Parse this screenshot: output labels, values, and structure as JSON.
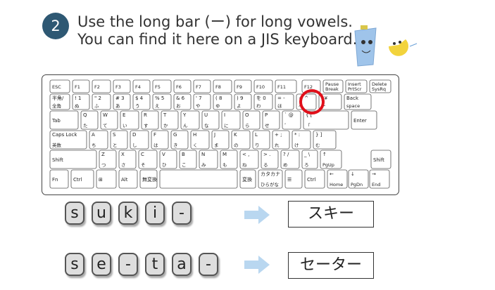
{
  "step": {
    "number": "2"
  },
  "instruction": {
    "text": "Use the long bar (ー) for long vowels. You can find it here on a JIS keyboard."
  },
  "keyboard": {
    "rows": [
      [
        [
          "ESC",
          ""
        ],
        [
          "F1",
          ""
        ],
        [
          "F2",
          ""
        ],
        [
          "F3",
          ""
        ],
        [
          "F4",
          ""
        ],
        [
          "F5",
          ""
        ],
        [
          "F6",
          ""
        ],
        [
          "F7",
          ""
        ],
        [
          "F8",
          ""
        ],
        [
          "F9",
          ""
        ],
        [
          "F10",
          ""
        ],
        [
          "F11",
          ""
        ],
        [
          "F12",
          ""
        ],
        [
          "Pause",
          "Break"
        ],
        [
          "Insert",
          "PrtScr"
        ],
        [
          "Delete",
          "SysRq"
        ]
      ],
      [
        [
          "半角/",
          "全角"
        ],
        [
          "! 1",
          "ぬ"
        ],
        [
          "\" 2",
          "ふ"
        ],
        [
          "# 3",
          "あ"
        ],
        [
          "$ 4",
          "う"
        ],
        [
          "% 5",
          "え"
        ],
        [
          "& 6",
          "お"
        ],
        [
          "' 7",
          "や"
        ],
        [
          "( 8",
          "ゆ"
        ],
        [
          ") 9",
          "よ"
        ],
        [
          "を 0",
          "わ"
        ],
        [
          "= -",
          "ほ"
        ],
        [
          "~ ^",
          "へ"
        ],
        [
          "| ¥",
          "ー"
        ],
        [
          "Back",
          "space"
        ]
      ],
      [
        [
          "Tab",
          ""
        ],
        [
          "Q",
          "た"
        ],
        [
          "W",
          "て"
        ],
        [
          "E",
          "い"
        ],
        [
          "R",
          "す"
        ],
        [
          "T",
          "か"
        ],
        [
          "Y",
          "ん"
        ],
        [
          "U",
          "な"
        ],
        [
          "I",
          "に"
        ],
        [
          "O",
          "ら"
        ],
        [
          "P",
          "せ"
        ],
        [
          "` @",
          "゛"
        ],
        [
          "{ [",
          "「"
        ],
        [
          "Enter",
          ""
        ]
      ],
      [
        [
          "Caps Lock",
          "英数"
        ],
        [
          "A",
          "ち"
        ],
        [
          "S",
          "と"
        ],
        [
          "D",
          "し"
        ],
        [
          "F",
          "は"
        ],
        [
          "G",
          "き"
        ],
        [
          "H",
          "く"
        ],
        [
          "J",
          "ま"
        ],
        [
          "K",
          "の"
        ],
        [
          "L",
          "り"
        ],
        [
          "+ ;",
          "れ"
        ],
        [
          "* :",
          "け"
        ],
        [
          "} ]",
          "む"
        ]
      ],
      [
        [
          "Shift",
          ""
        ],
        [
          "Z",
          "つ"
        ],
        [
          "X",
          "さ"
        ],
        [
          "C",
          "そ"
        ],
        [
          "V",
          "ひ"
        ],
        [
          "B",
          "こ"
        ],
        [
          "N",
          "み"
        ],
        [
          "M",
          "も"
        ],
        [
          "< ,",
          "ね"
        ],
        [
          "> .",
          "る"
        ],
        [
          "? /",
          "め"
        ],
        [
          "_ \\",
          "ろ"
        ],
        [
          "↑",
          "PgUp"
        ],
        [
          "Shift",
          ""
        ]
      ],
      [
        [
          "Fn",
          ""
        ],
        [
          "Ctrl",
          ""
        ],
        [
          "⊞",
          ""
        ],
        [
          "Alt",
          ""
        ],
        [
          "無変換",
          ""
        ],
        [
          "",
          ""
        ],
        [
          "変換",
          ""
        ],
        [
          "カタカナ",
          "ひらがな"
        ],
        [
          "☰",
          ""
        ],
        [
          "Ctrl",
          ""
        ],
        [
          "←",
          "Home"
        ],
        [
          "↓",
          "PgDn"
        ],
        [
          "→",
          "End"
        ]
      ]
    ]
  },
  "examples": [
    {
      "tiles": [
        "s",
        "u",
        "k",
        "i",
        "-"
      ],
      "result": "スキー"
    },
    {
      "tiles": [
        "s",
        "e",
        "-",
        "t",
        "a",
        "-"
      ],
      "result": "セーター"
    }
  ],
  "colors": {
    "highlight": "#e0101a",
    "arrow": "#b9d7f0",
    "badge": "#2e5873"
  }
}
